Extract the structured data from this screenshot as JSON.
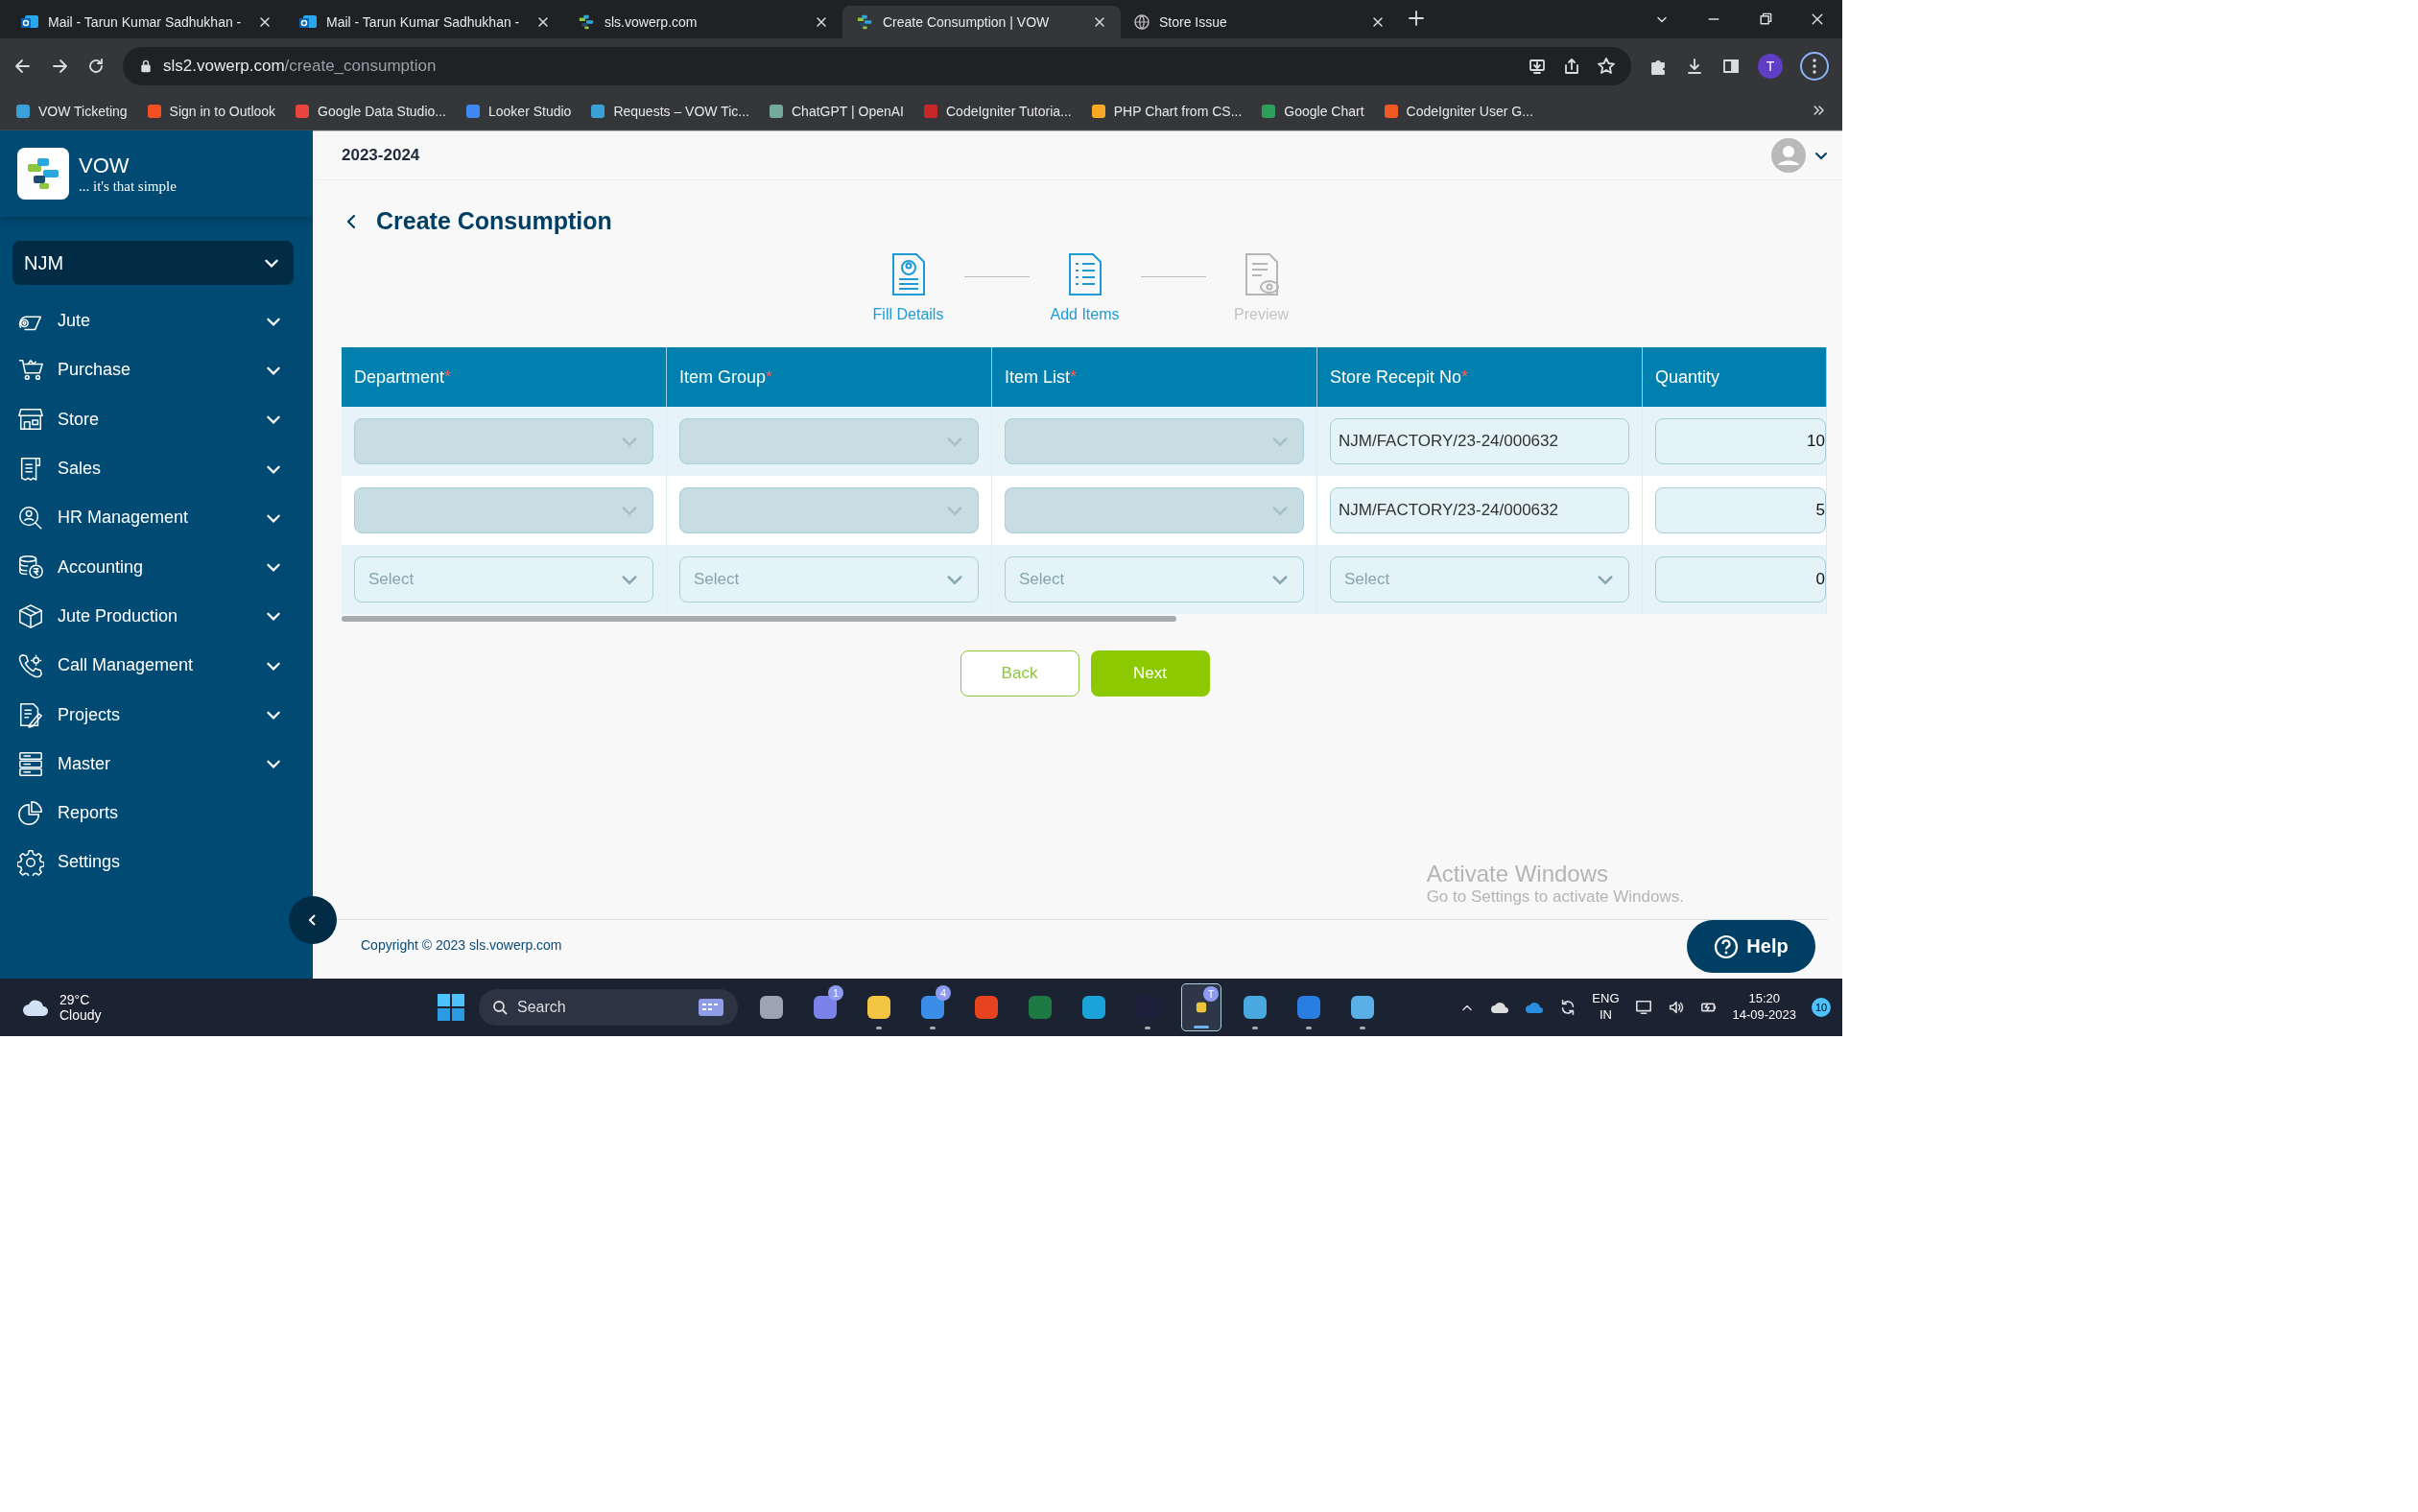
{
  "browser": {
    "tabs": [
      {
        "title": "Mail - Tarun Kumar Sadhukhan -",
        "selected": false
      },
      {
        "title": "Mail - Tarun Kumar Sadhukhan -",
        "selected": false
      },
      {
        "title": "sls.vowerp.com",
        "selected": false
      },
      {
        "title": "Create Consumption | VOW",
        "selected": true
      },
      {
        "title": "Store Issue",
        "selected": false
      }
    ],
    "address": {
      "host": "sls2.vowerp.com",
      "path": "/create_consumption"
    },
    "profile_initial": "T",
    "bookmarks": [
      {
        "label": "VOW Ticketing",
        "color": "#3aa0d8"
      },
      {
        "label": "Sign in to Outlook",
        "color": "#f25022"
      },
      {
        "label": "Google Data Studio...",
        "color": "#e8453c"
      },
      {
        "label": "Looker Studio",
        "color": "#4285f4"
      },
      {
        "label": "Requests – VOW Tic...",
        "color": "#3aa0d8"
      },
      {
        "label": "ChatGPT | OpenAI",
        "color": "#74aa9c"
      },
      {
        "label": "CodeIgniter Tutoria...",
        "color": "#c62828"
      },
      {
        "label": "PHP Chart from CS...",
        "color": "#f9a825"
      },
      {
        "label": "Google Chart",
        "color": "#2e9e5b"
      },
      {
        "label": "CodeIgniter User G...",
        "color": "#ef5a24"
      }
    ]
  },
  "sidebar": {
    "brand": "VOW",
    "tagline": "... it's that simple",
    "company": "NJM",
    "menu": [
      {
        "label": "Jute",
        "expandable": true
      },
      {
        "label": "Purchase",
        "expandable": true
      },
      {
        "label": "Store",
        "expandable": true
      },
      {
        "label": "Sales",
        "expandable": true
      },
      {
        "label": "HR Management",
        "expandable": true
      },
      {
        "label": "Accounting",
        "expandable": true
      },
      {
        "label": "Jute Production",
        "expandable": true
      },
      {
        "label": "Call Management",
        "expandable": true
      },
      {
        "label": "Projects",
        "expandable": true
      },
      {
        "label": "Master",
        "expandable": true
      },
      {
        "label": "Reports",
        "expandable": false
      },
      {
        "label": "Settings",
        "expandable": false
      }
    ]
  },
  "header": {
    "year": "2023-2024"
  },
  "page": {
    "title": "Create Consumption",
    "steps": [
      {
        "label": "Fill Details",
        "active": true
      },
      {
        "label": "Add Items",
        "active": true
      },
      {
        "label": "Preview",
        "active": false
      }
    ],
    "table": {
      "columns": [
        {
          "label": "Department",
          "required_mark": "*"
        },
        {
          "label": "Item Group",
          "required_mark": "*"
        },
        {
          "label": "Item List",
          "required_mark": "*"
        },
        {
          "label": "Store Recepit No",
          "required_mark": "*"
        },
        {
          "label": "Quantity"
        }
      ],
      "rows": [
        {
          "cells": [
            {
              "kind": "select",
              "disabled": true
            },
            {
              "kind": "select",
              "disabled": true
            },
            {
              "kind": "select",
              "disabled": true
            },
            {
              "kind": "text",
              "value": "NJM/FACTORY/23-24/000632"
            },
            {
              "kind": "number",
              "value": "10"
            }
          ]
        },
        {
          "cells": [
            {
              "kind": "select",
              "disabled": true
            },
            {
              "kind": "select",
              "disabled": true
            },
            {
              "kind": "select",
              "disabled": true
            },
            {
              "kind": "text",
              "value": "NJM/FACTORY/23-24/000632"
            },
            {
              "kind": "number",
              "value": "5"
            }
          ]
        },
        {
          "cells": [
            {
              "kind": "select",
              "disabled": false,
              "placeholder": "Select"
            },
            {
              "kind": "select",
              "disabled": false,
              "placeholder": "Select"
            },
            {
              "kind": "select",
              "disabled": false,
              "placeholder": "Select"
            },
            {
              "kind": "select",
              "disabled": false,
              "placeholder": "Select"
            },
            {
              "kind": "number",
              "value": "0"
            }
          ]
        }
      ]
    },
    "buttons": [
      {
        "label": "Back",
        "kind": "outline"
      },
      {
        "label": "Next",
        "kind": "primary"
      }
    ]
  },
  "footer": {
    "copyright": "Copyright © 2023 sls.vowerp.com",
    "help": "Help"
  },
  "activation": {
    "title": "Activate Windows",
    "hint": "Go to Settings to activate Windows."
  },
  "taskbar": {
    "temperature": "29°C",
    "condition": "Cloudy",
    "search_placeholder": "Search",
    "apps": [
      {
        "color": "#9aa4b2",
        "running": false
      },
      {
        "color": "#7b83eb",
        "running": false,
        "badge": "1"
      },
      {
        "color": "#f4c542",
        "running": true
      },
      {
        "color": "#3b8ee8",
        "running": true,
        "badge": "4"
      },
      {
        "color": "#e6431e",
        "running": false
      },
      {
        "color": "#1d7a43",
        "running": false
      },
      {
        "color": "#1aa3d8",
        "running": false
      },
      {
        "color": "#1b1f3a",
        "running": true
      },
      {
        "color": "#e9c53b",
        "running": true,
        "selected": true,
        "badge": "T"
      },
      {
        "color": "#4aa8e0",
        "running": true
      },
      {
        "color": "#2a7de1",
        "running": true
      },
      {
        "color": "#5ab0e6",
        "running": true
      }
    ],
    "language": "ENG",
    "region": "IN",
    "time": "15:20",
    "date": "14-09-2023",
    "notifications": "10"
  }
}
